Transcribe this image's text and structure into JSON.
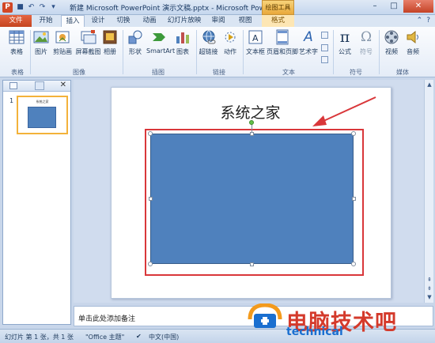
{
  "window": {
    "app_icon": "P",
    "title": "新建 Microsoft PowerPoint 演示文稿.pptx - Microsoft PowerPo...",
    "context_tab": "绘图工具"
  },
  "tabs": [
    {
      "label": "文件"
    },
    {
      "label": "开始"
    },
    {
      "label": "插入"
    },
    {
      "label": "设计"
    },
    {
      "label": "切换"
    },
    {
      "label": "动画"
    },
    {
      "label": "幻灯片放映"
    },
    {
      "label": "审阅"
    },
    {
      "label": "视图"
    },
    {
      "label": "格式"
    }
  ],
  "ribbon": {
    "buttons": [
      {
        "label": "表格",
        "icon": "table-icon"
      },
      {
        "label": "图片",
        "icon": "picture-icon"
      },
      {
        "label": "剪贴画",
        "icon": "clipart-icon"
      },
      {
        "label": "屏幕截图",
        "icon": "screenshot-icon"
      },
      {
        "label": "相册",
        "icon": "album-icon"
      },
      {
        "label": "形状",
        "icon": "shapes-icon"
      },
      {
        "label": "SmartArt",
        "icon": "smartart-icon"
      },
      {
        "label": "图表",
        "icon": "chart-icon"
      },
      {
        "label": "超链接",
        "icon": "hyperlink-icon"
      },
      {
        "label": "动作",
        "icon": "action-icon"
      },
      {
        "label": "文本框",
        "icon": "textbox-icon"
      },
      {
        "label": "页眉和页脚",
        "icon": "header-footer-icon"
      },
      {
        "label": "艺术字",
        "icon": "wordart-icon"
      },
      {
        "label": "公式",
        "icon": "equation-icon"
      },
      {
        "label": "符号",
        "icon": "symbol-icon"
      },
      {
        "label": "视频",
        "icon": "video-icon"
      },
      {
        "label": "音频",
        "icon": "audio-icon"
      }
    ],
    "groups": [
      "表格",
      "图像",
      "插图",
      "链接",
      "文本",
      "符号",
      "媒体"
    ],
    "equation_glyph": "π",
    "symbol_glyph": "Ω",
    "wordart_glyph": "A"
  },
  "slides_panel": {
    "slide_number": "1",
    "thumb_title": "系统之家"
  },
  "slide": {
    "title": "系统之家",
    "shape_color": "#4f81bd",
    "highlight_color": "#d9373a"
  },
  "notes": {
    "placeholder": "单击此处添加备注"
  },
  "status": {
    "slide_info": "幻灯片 第 1 张，共 1 张",
    "theme": "\"Office 主题\"",
    "language": "中文(中国)"
  },
  "watermark": {
    "text": "电脑技术吧",
    "sub": "technical"
  }
}
